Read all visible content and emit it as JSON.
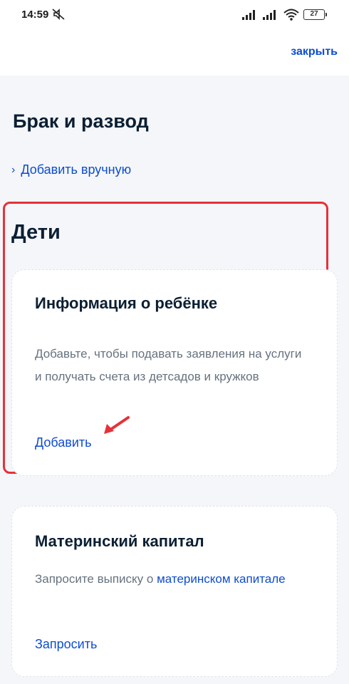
{
  "status_bar": {
    "time": "14:59",
    "battery": "27",
    "icons": [
      "mute-icon",
      "signal-icon",
      "signal-icon",
      "wifi-icon",
      "battery-icon"
    ]
  },
  "header": {
    "close_label": "закрыть"
  },
  "marriage": {
    "title": "Брак и развод",
    "add_manual_label": "Добавить вручную"
  },
  "children": {
    "title": "Дети",
    "card": {
      "title": "Информация о ребёнке",
      "description": "Добавьте, чтобы подавать заявления на услуги и получать счета из детсадов и кружков",
      "action_label": "Добавить"
    }
  },
  "capital": {
    "title": "Материнский капитал",
    "description_prefix": "Запросите выписку о ",
    "description_link": "материнском капитале",
    "action_label": "Запросить"
  },
  "colors": {
    "accent": "#0d4cd3",
    "highlight": "#e5313a",
    "text": "#0b1f33",
    "muted": "#66727f",
    "background": "#f4f6f9"
  }
}
